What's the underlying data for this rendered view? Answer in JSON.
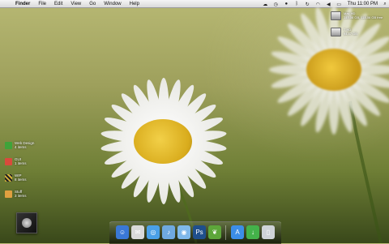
{
  "menubar": {
    "app_name": "Finder",
    "menus": [
      "File",
      "Edit",
      "View",
      "Go",
      "Window",
      "Help"
    ],
    "clock": "Thu 11:00 PM"
  },
  "drives": [
    {
      "name": "Mac HD",
      "detail": "149.06 GB, 118.06 GB free"
    },
    {
      "name": "T HD",
      "detail": "94.47 GB"
    }
  ],
  "stacks": [
    {
      "name": "Web Design",
      "count": "4 items",
      "color": "#3fa33a"
    },
    {
      "name": "GUI",
      "count": "1 items",
      "color": "#d94a3c"
    },
    {
      "name": "WIP",
      "count": "8 items",
      "color": "#d8b23a"
    },
    {
      "name": "Stuff",
      "count": "3 items",
      "color": "#e0a040"
    }
  ],
  "dock": [
    {
      "name": "finder-icon",
      "color": "#3a78d6",
      "glyph": "☺"
    },
    {
      "name": "mail-icon",
      "color": "#d9d9d9",
      "glyph": "✉"
    },
    {
      "name": "safari-icon",
      "color": "#4aa0e8",
      "glyph": "◎"
    },
    {
      "name": "itunes-icon",
      "color": "#6fa9e0",
      "glyph": "♪"
    },
    {
      "name": "ical-icon",
      "color": "#7fb8ea",
      "glyph": "◉"
    },
    {
      "name": "photoshop-icon",
      "color": "#1f4f8c",
      "glyph": "Ps"
    },
    {
      "name": "leaf-app-icon",
      "color": "#5da63a",
      "glyph": "❦"
    },
    {
      "name": "app-store-icon",
      "color": "#3c8ee8",
      "glyph": "A"
    },
    {
      "name": "downloads-icon",
      "color": "#44b24a",
      "glyph": "↓"
    },
    {
      "name": "trash-icon",
      "color": "#cfd3d8",
      "glyph": "▯"
    }
  ]
}
